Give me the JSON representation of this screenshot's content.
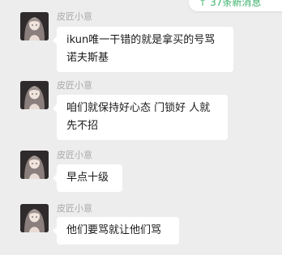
{
  "unread_banner": {
    "text": "37条新消息",
    "arrow": "↑",
    "color": "#3bb36b"
  },
  "messages": [
    {
      "sender": "皮匠小意",
      "lines": [
        "ikun唯一干错的就是拿买的号骂",
        "诺夫斯基"
      ]
    },
    {
      "sender": "皮匠小意",
      "lines": [
        "咱们就保持好心态 门锁好 人就",
        "先不招"
      ]
    },
    {
      "sender": "皮匠小意",
      "lines": [
        "早点十级"
      ]
    },
    {
      "sender": "皮匠小意",
      "lines": [
        "他们要骂就让他们骂"
      ]
    }
  ],
  "avatar_icon": "anime-girl-avatar-icon"
}
